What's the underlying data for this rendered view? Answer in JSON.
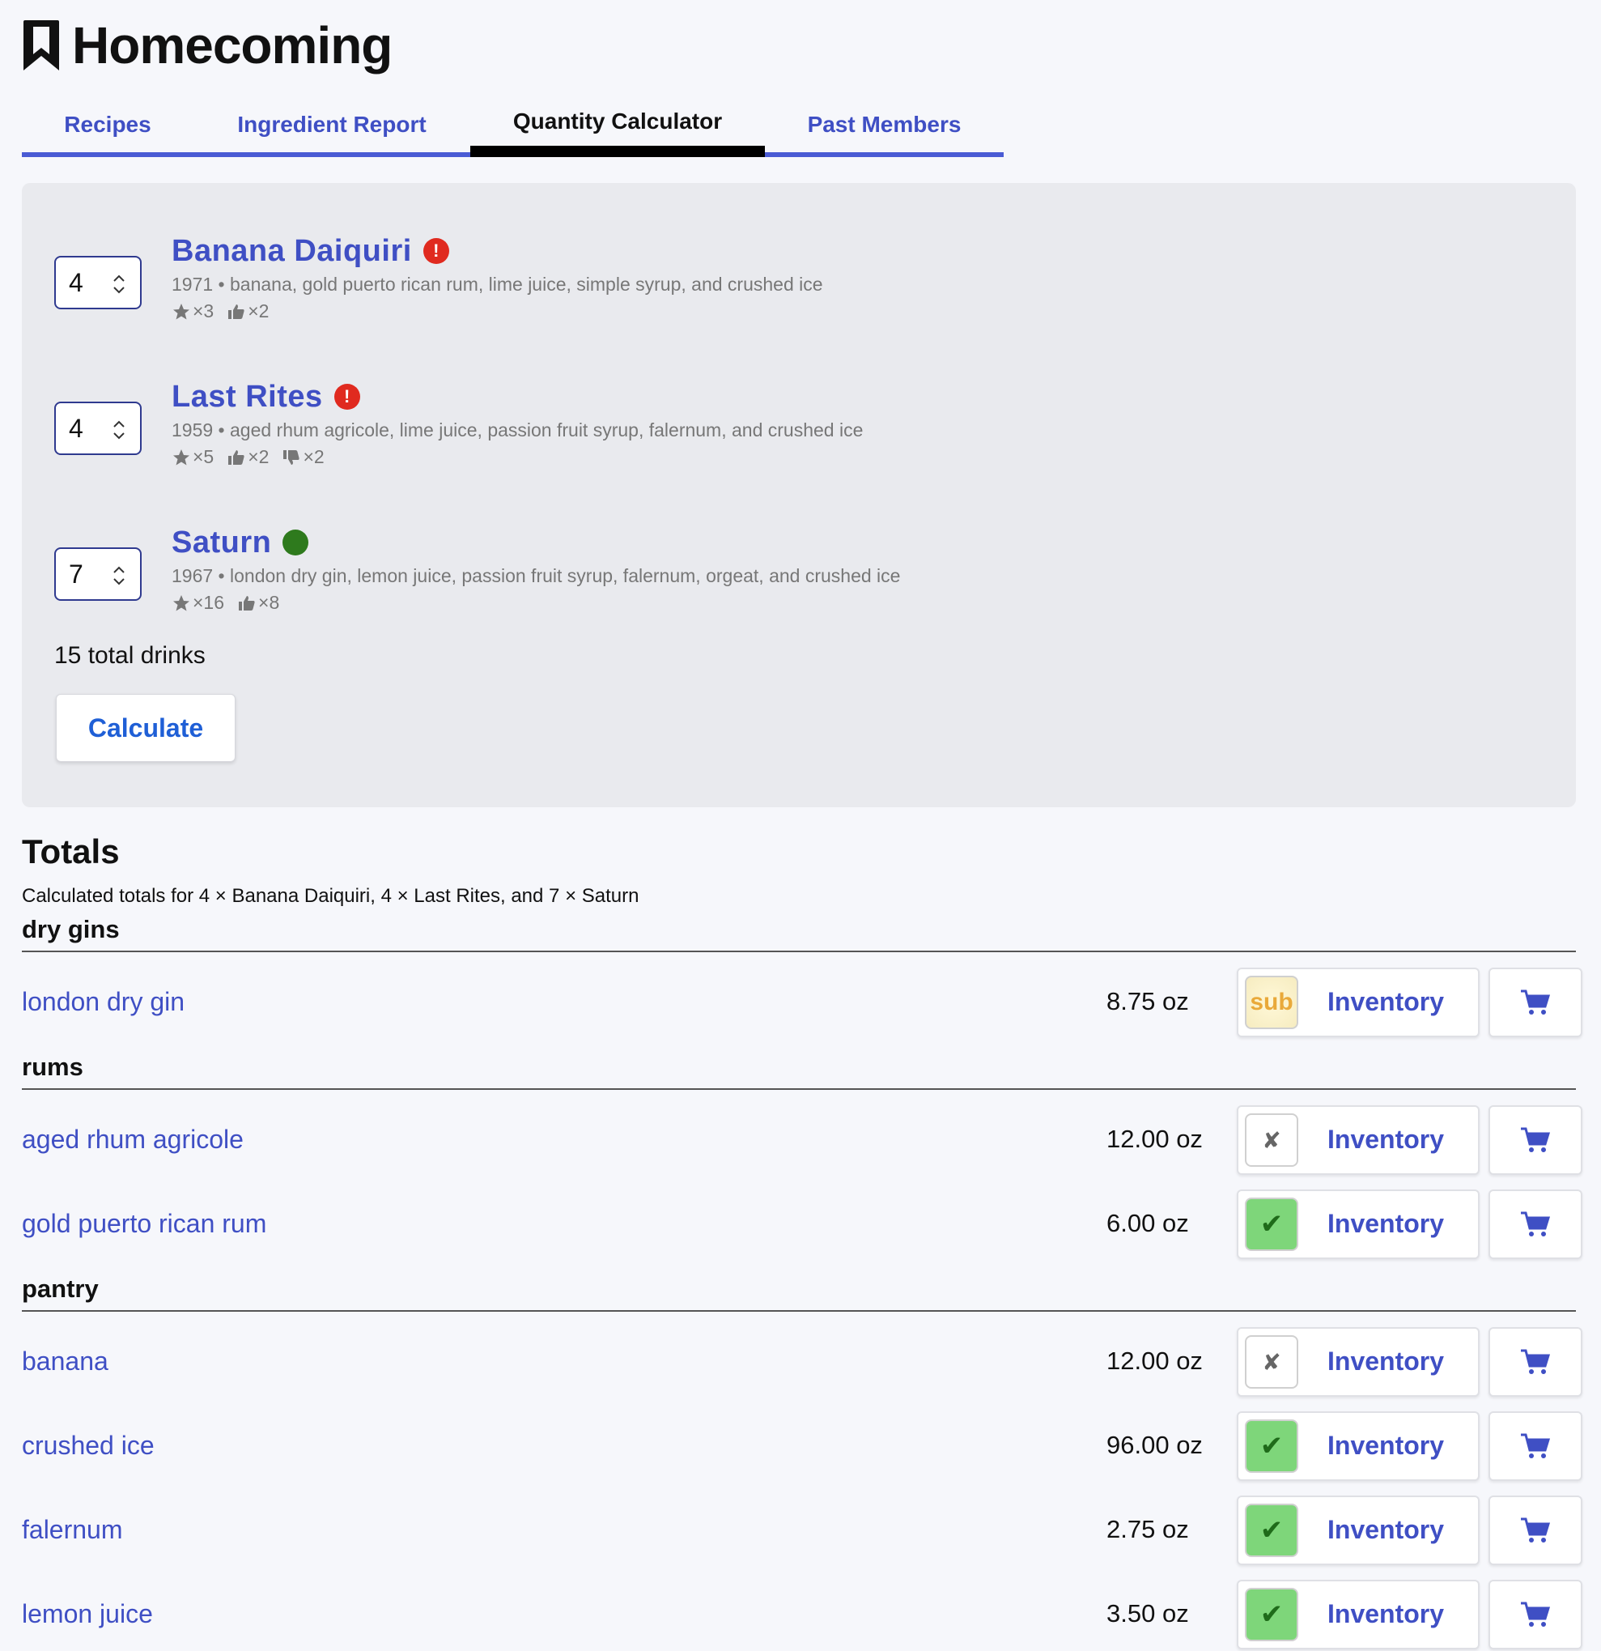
{
  "app": {
    "title": "Homecoming",
    "logo_icon": "bookmark-icon"
  },
  "tabs": [
    {
      "label": "Recipes",
      "active": false
    },
    {
      "label": "Ingredient Report",
      "active": false
    },
    {
      "label": "Quantity Calculator",
      "active": true
    },
    {
      "label": "Past Members",
      "active": false
    }
  ],
  "drinks": [
    {
      "quantity": "4",
      "name": "Banana Daiquiri",
      "badge": "!",
      "badge_type": "warning",
      "description": "1971 • banana, gold puerto rican rum, lime juice, simple syrup, and crushed ice",
      "stats": [
        {
          "icon": "star-icon",
          "text": "×3"
        },
        {
          "icon": "thumbs-up-icon",
          "text": "×2"
        }
      ]
    },
    {
      "quantity": "4",
      "name": "Last Rites",
      "badge": "!",
      "badge_type": "warning",
      "description": "1959 • aged rhum agricole, lime juice, passion fruit syrup, falernum, and crushed ice",
      "stats": [
        {
          "icon": "star-icon",
          "text": "×5"
        },
        {
          "icon": "thumbs-up-icon",
          "text": "×2"
        },
        {
          "icon": "thumbs-down-icon",
          "text": "×2"
        }
      ]
    },
    {
      "quantity": "7",
      "name": "Saturn",
      "badge": "",
      "badge_type": "ok",
      "description": "1967 • london dry gin, lemon juice, passion fruit syrup, falernum, orgeat, and crushed ice",
      "stats": [
        {
          "icon": "star-icon",
          "text": "×16"
        },
        {
          "icon": "thumbs-up-icon",
          "text": "×8"
        }
      ]
    }
  ],
  "total_drinks": "15 total drinks",
  "calculate_label": "Calculate",
  "totals": {
    "title": "Totals",
    "subtitle": "Calculated totals for 4 × Banana Daiquiri, 4 × Last Rites, and 7 × Saturn",
    "groups": [
      {
        "name": "dry gins",
        "items": [
          {
            "name": "london dry gin",
            "amount": "8.75 oz",
            "status": "sub",
            "status_text": "sub",
            "inventory_label": "Inventory"
          }
        ]
      },
      {
        "name": "rums",
        "items": [
          {
            "name": "aged rhum agricole",
            "amount": "12.00 oz",
            "status": "missing",
            "status_text": "✘",
            "inventory_label": "Inventory"
          },
          {
            "name": "gold puerto rican rum",
            "amount": "6.00 oz",
            "status": "have",
            "status_text": "✔",
            "inventory_label": "Inventory"
          }
        ]
      },
      {
        "name": "pantry",
        "items": [
          {
            "name": "banana",
            "amount": "12.00 oz",
            "status": "missing",
            "status_text": "✘",
            "inventory_label": "Inventory"
          },
          {
            "name": "crushed ice",
            "amount": "96.00 oz",
            "status": "have",
            "status_text": "✔",
            "inventory_label": "Inventory"
          },
          {
            "name": "falernum",
            "amount": "2.75 oz",
            "status": "have",
            "status_text": "✔",
            "inventory_label": "Inventory"
          },
          {
            "name": "lemon juice",
            "amount": "3.50 oz",
            "status": "have",
            "status_text": "✔",
            "inventory_label": "Inventory"
          }
        ]
      }
    ]
  },
  "colors": {
    "accent": "#3f4fc4",
    "tab_underline": "#4a5bd4",
    "warning": "#e02a1f",
    "ok": "#2e7a1d",
    "have": "#7ed67a",
    "sub_text": "#e9a93a"
  }
}
